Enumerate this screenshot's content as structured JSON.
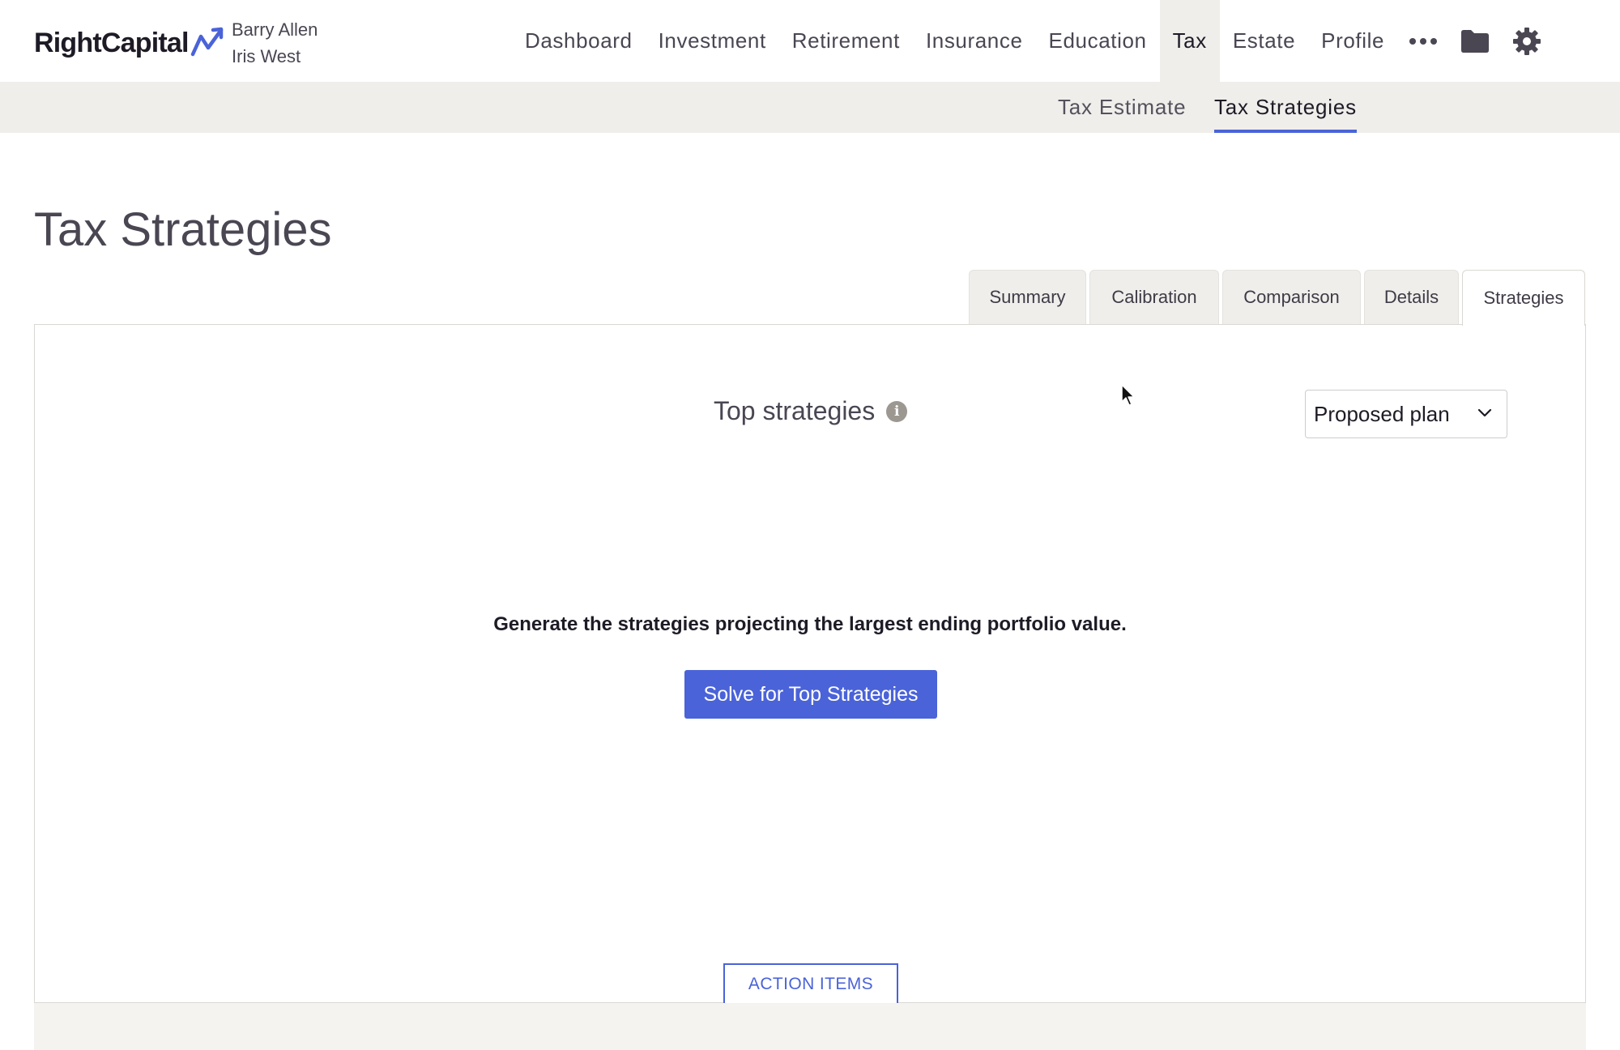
{
  "brand": {
    "logo_text": "RightCapital",
    "accent": "#4a63d8"
  },
  "clients": {
    "primary": "Barry Allen",
    "spouse": "Iris West"
  },
  "nav": {
    "items": [
      "Dashboard",
      "Investment",
      "Retirement",
      "Insurance",
      "Education",
      "Tax",
      "Estate",
      "Profile"
    ],
    "active": "Tax",
    "icons": [
      "more-icon",
      "folder-icon",
      "gear-icon"
    ]
  },
  "subnav": {
    "items": [
      "Tax Estimate",
      "Tax Strategies"
    ],
    "active": "Tax Strategies"
  },
  "page": {
    "title": "Tax Strategies"
  },
  "tabs": {
    "items": [
      "Summary",
      "Calibration",
      "Comparison",
      "Details",
      "Strategies"
    ],
    "active": "Strategies"
  },
  "panel": {
    "title": "Top strategies",
    "plan_select": {
      "value": "Proposed plan"
    },
    "prompt": "Generate the strategies projecting the largest ending portfolio value.",
    "solve_button": "Solve for Top Strategies",
    "action_items_button": "ACTION ITEMS"
  }
}
